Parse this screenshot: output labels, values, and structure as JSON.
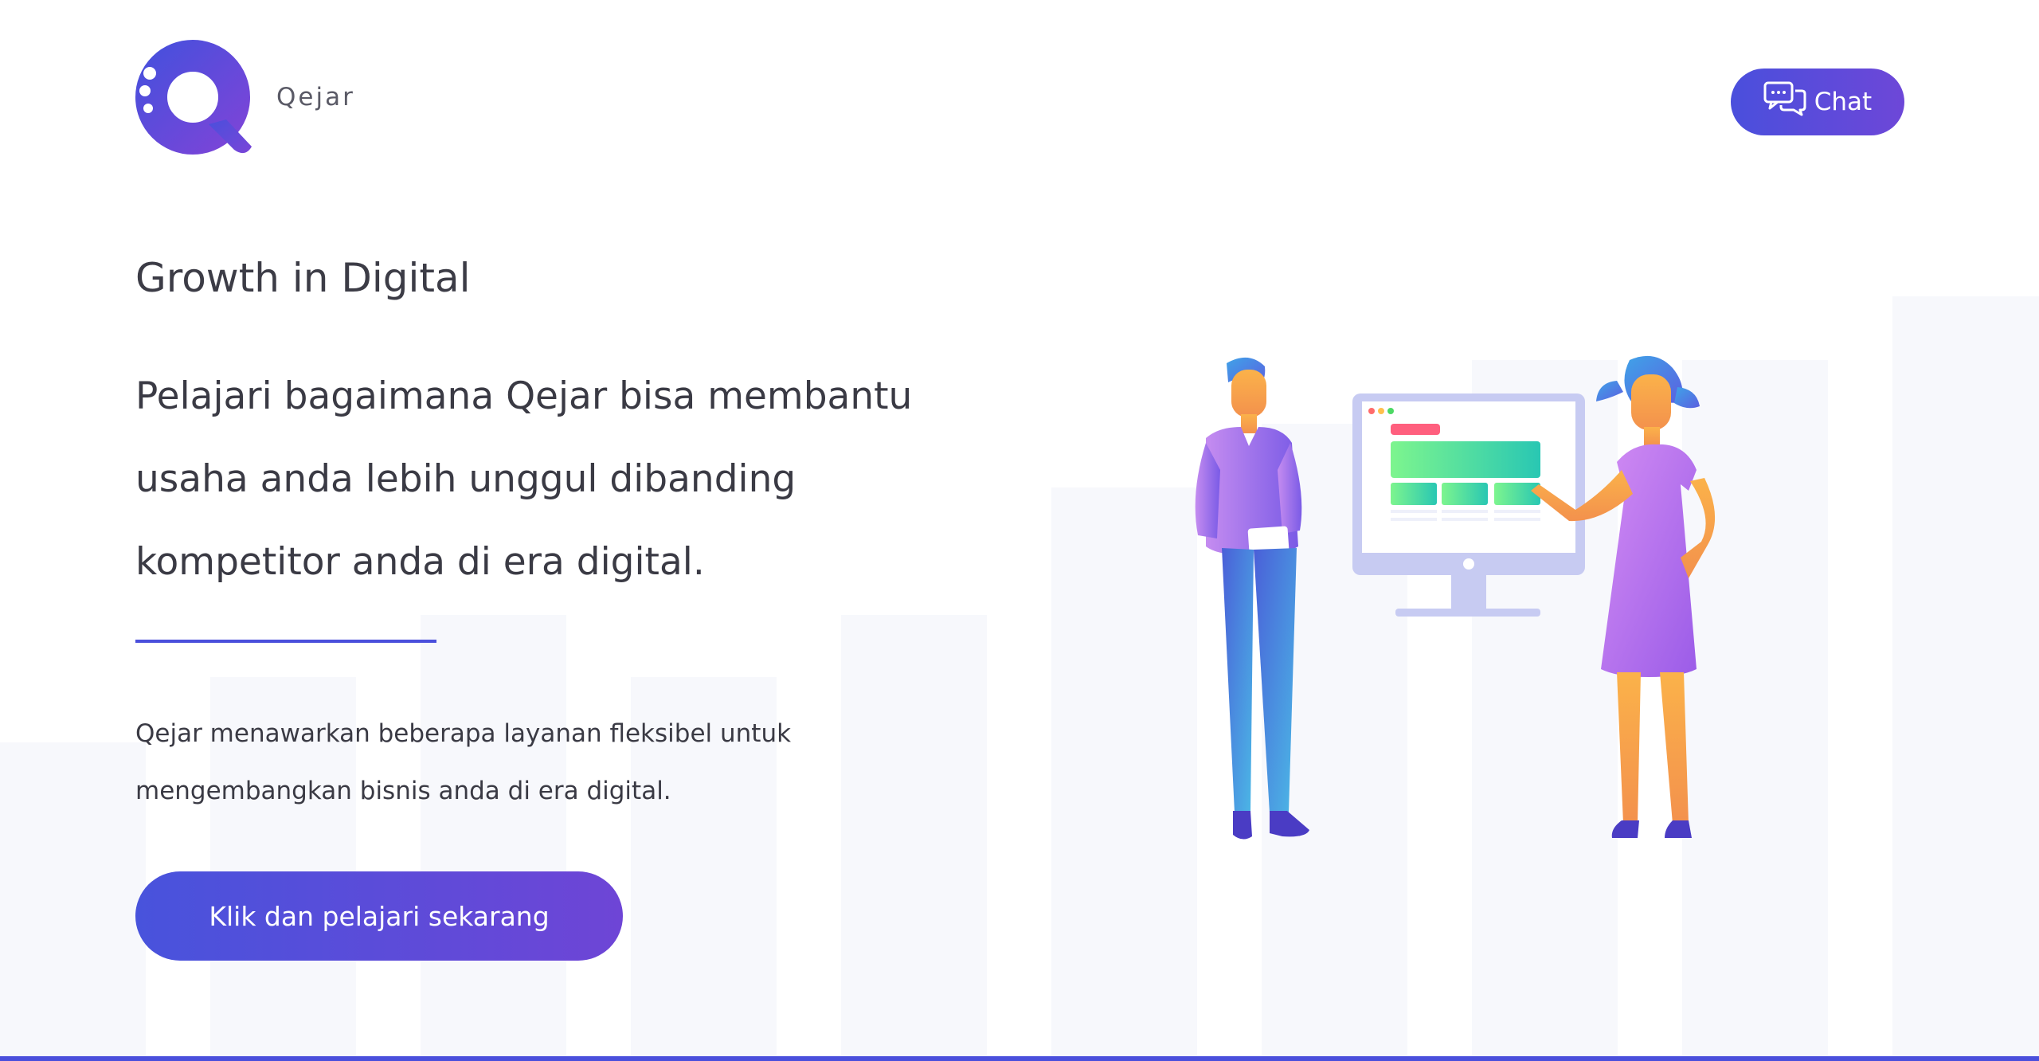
{
  "header": {
    "brand_name": "Qejar",
    "chat_label": "Chat"
  },
  "hero": {
    "title": "Growth in Digital",
    "subtitle_lines": [
      "Pelajari bagaimana Qejar bisa membantu",
      "usaha anda lebih unggul dibanding",
      "kompetitor anda di era digital."
    ],
    "description_lines": [
      "Qejar menawarkan beberapa layanan fleksibel untuk",
      "mengembangkan bisnis anda di era digital."
    ],
    "cta_label": "Klik dan pelajari sekarang"
  },
  "icons": {
    "logo": "qejar-logo-icon",
    "chat": "chat-bubbles-icon"
  },
  "colors": {
    "accent": "#4a4fdc",
    "accent_purple": "#6d47d8",
    "text": "#3c3c46",
    "bar_background": "#f7f8fc"
  }
}
